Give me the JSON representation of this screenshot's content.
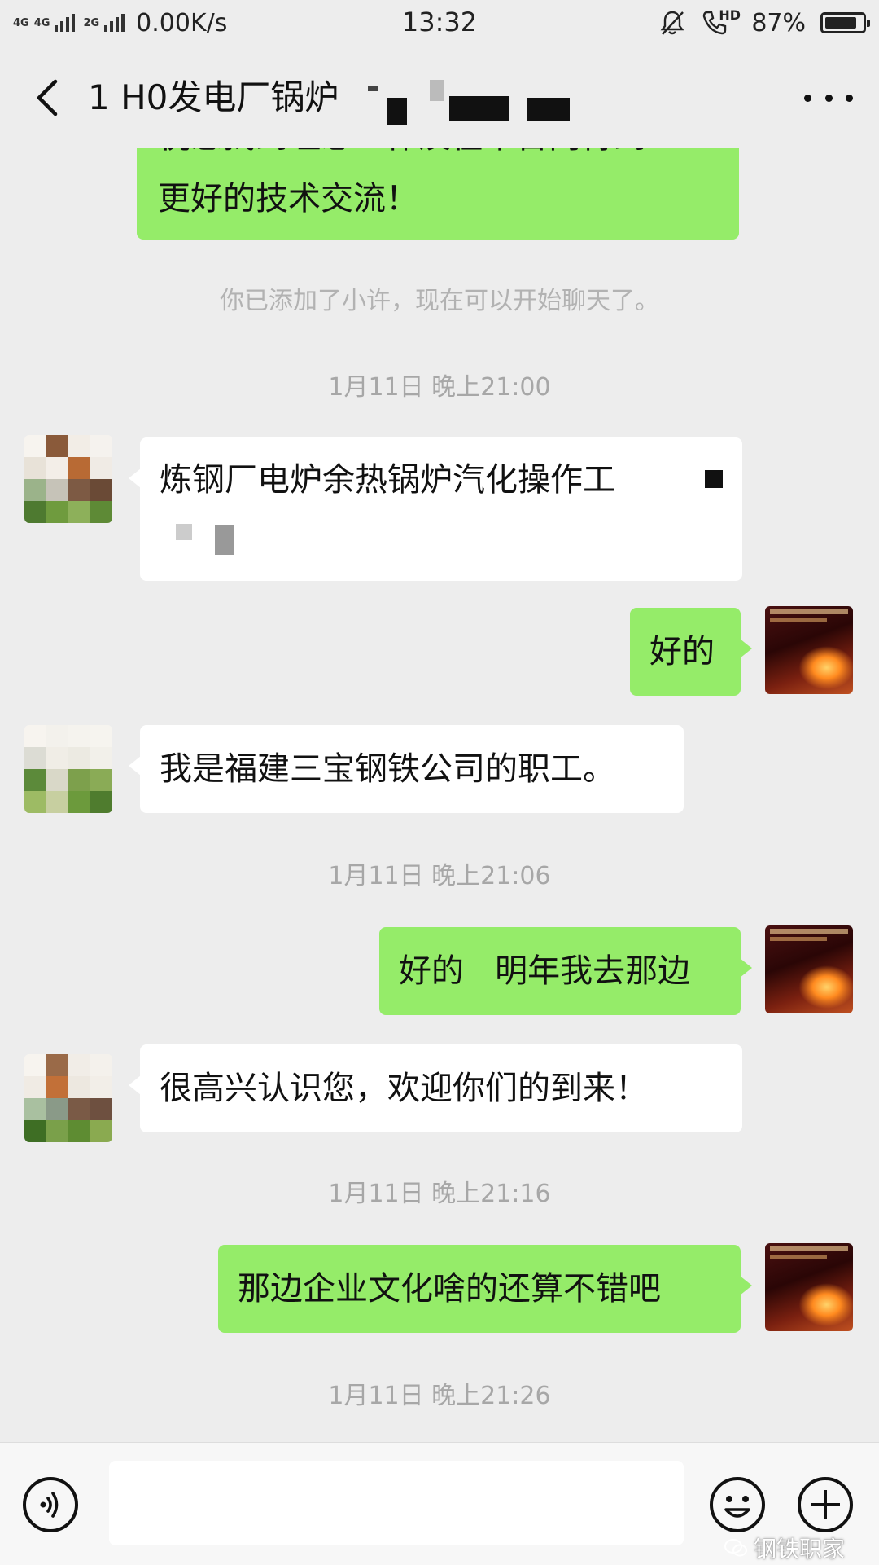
{
  "status_bar": {
    "net_1": "4G",
    "net_2": "4G",
    "net_3": "2G",
    "speed": "0.00K/s",
    "time": "13:32",
    "hd": "HD",
    "battery_text": "87%",
    "battery_level": 0.87,
    "icons": [
      "signal-icon",
      "mute-icon",
      "hd-call-icon",
      "battery-icon"
    ]
  },
  "header": {
    "title": "1 H0发电厂锅炉",
    "icons": [
      "back-arrow-icon",
      "more-icon"
    ]
  },
  "messages": [
    {
      "side": "right",
      "type": "text",
      "text": "更好的技术交流！",
      "partial_top_line": "祝您找到理想工作及在平台内得到"
    },
    {
      "type": "system",
      "text": "你已添加了小许，现在可以开始聊天了。"
    },
    {
      "type": "time",
      "text": "1月11日 晚上21:00"
    },
    {
      "side": "left",
      "type": "text",
      "text": "炼钢厂电炉余热锅炉汽化操作工"
    },
    {
      "side": "right",
      "type": "text",
      "text": "好的"
    },
    {
      "side": "left",
      "type": "text",
      "text": "我是福建三宝钢铁公司的职工。"
    },
    {
      "type": "time",
      "text": "1月11日 晚上21:06"
    },
    {
      "side": "right",
      "type": "text",
      "text": "好的   明年我去那边"
    },
    {
      "side": "left",
      "type": "text",
      "text": "很高兴认识您，欢迎你们的到来！"
    },
    {
      "type": "time",
      "text": "1月11日 晚上21:16"
    },
    {
      "side": "right",
      "type": "text",
      "text": "那边企业文化啥的还算不错吧"
    },
    {
      "type": "time",
      "text": "1月11日 晚上21:26"
    }
  ],
  "input_bar": {
    "placeholder": "",
    "icons": [
      "voice-icon",
      "emoji-icon",
      "plus-icon"
    ]
  },
  "watermark": "钢铁职家",
  "colors": {
    "background": "#ededed",
    "bubble_self": "#95ec69",
    "bubble_other": "#ffffff",
    "timestamp": "#a7a7a7"
  }
}
